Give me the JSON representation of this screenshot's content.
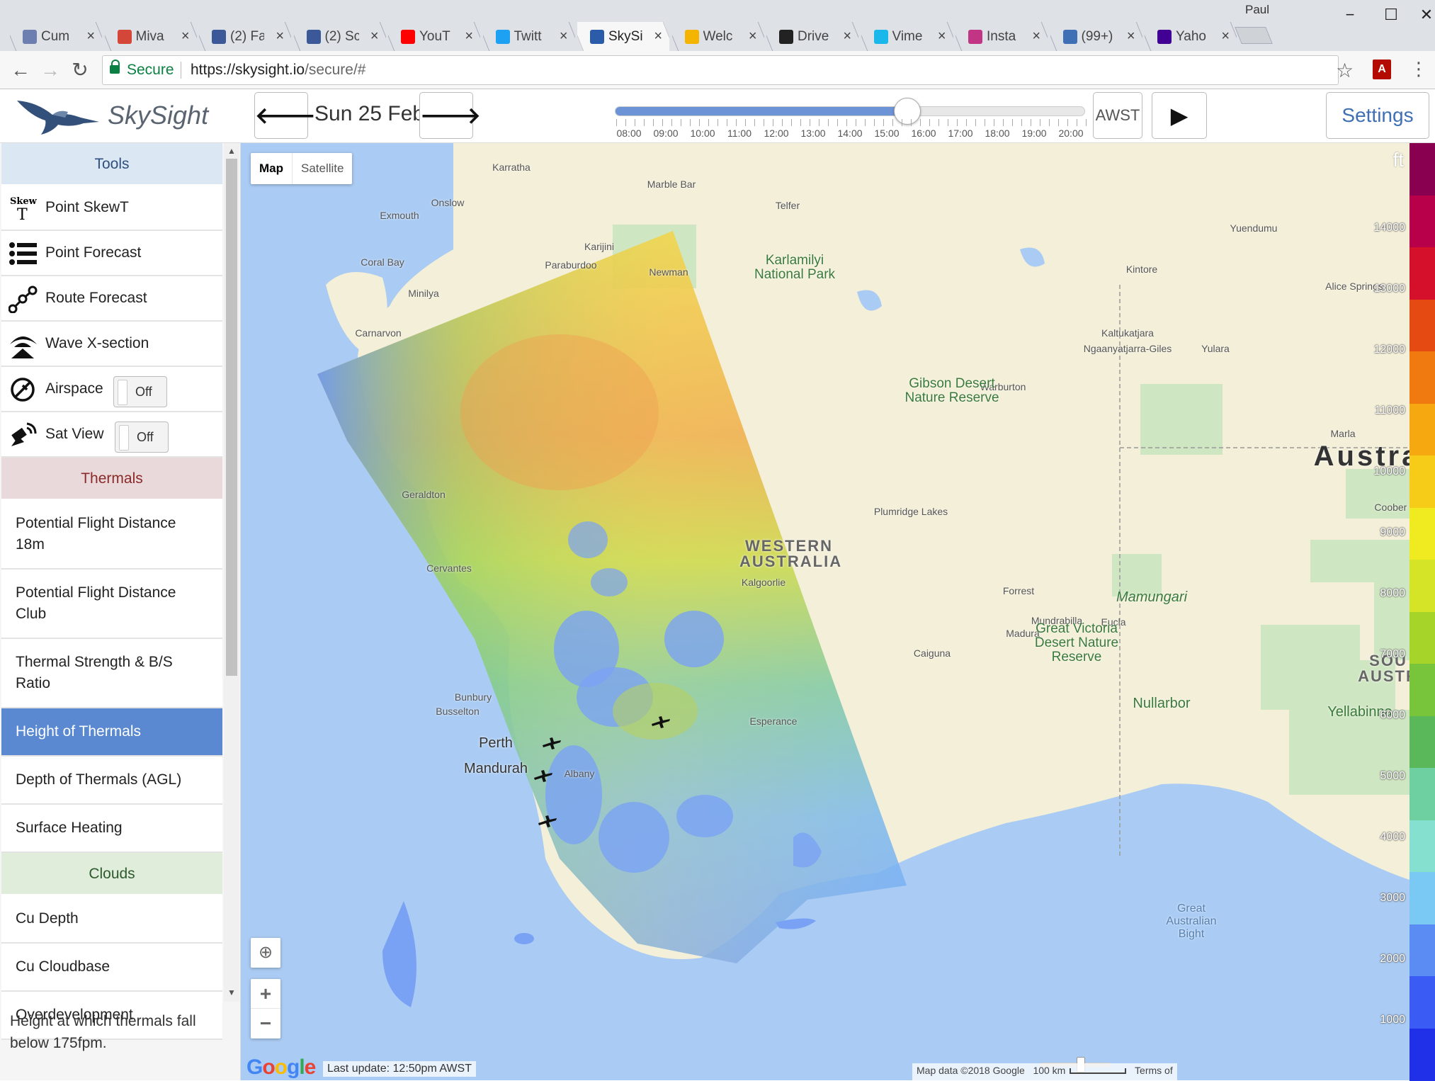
{
  "browser": {
    "profile": "Paul",
    "tabs": [
      {
        "label": "Cum",
        "icon": "feather-icon",
        "color": "#6d7fb0"
      },
      {
        "label": "Miva",
        "icon": "gmail-icon",
        "color": "#d44638"
      },
      {
        "label": "(2) Fa",
        "icon": "facebook-icon",
        "color": "#3b5998"
      },
      {
        "label": "(2) Sc",
        "icon": "facebook-icon",
        "color": "#3b5998"
      },
      {
        "label": "YouT",
        "icon": "youtube-icon",
        "color": "#ff0000"
      },
      {
        "label": "Twitt",
        "icon": "twitter-icon",
        "color": "#1da1f2"
      },
      {
        "label": "SkySi",
        "icon": "plane-icon",
        "color": "#2a5caa",
        "active": true
      },
      {
        "label": "Welc",
        "icon": "pinwheel-icon",
        "color": "#f4b400"
      },
      {
        "label": "Drive",
        "icon": "terminal-icon",
        "color": "#222222"
      },
      {
        "label": "Vime",
        "icon": "vimeo-icon",
        "color": "#1ab7ea"
      },
      {
        "label": "Insta",
        "icon": "instagram-icon",
        "color": "#c13584"
      },
      {
        "label": "(99+)",
        "icon": "mail-icon",
        "color": "#3f6fb5"
      },
      {
        "label": "Yaho",
        "icon": "yahoo-icon",
        "color": "#410093"
      }
    ],
    "secure_label": "Secure",
    "url_host": "https://skysight.io",
    "url_path": "/secure/#"
  },
  "app": {
    "title": "SkySight",
    "date": "Sun 25 Feb",
    "timezone": "AWST",
    "settings": "Settings",
    "time_labels": [
      "08:00",
      "09:00",
      "10:00",
      "11:00",
      "12:00",
      "13:00",
      "14:00",
      "15:00",
      "16:00",
      "17:00",
      "18:00",
      "19:00",
      "20:00"
    ],
    "time_position": 0.62
  },
  "sidebar": {
    "tools_header": "Tools",
    "tools": [
      {
        "label": "Point SkewT",
        "icon": "skewt-icon"
      },
      {
        "label": "Point Forecast",
        "icon": "list-icon"
      },
      {
        "label": "Route Forecast",
        "icon": "route-icon"
      },
      {
        "label": "Wave X-section",
        "icon": "wave-icon"
      },
      {
        "label": "Airspace",
        "icon": "airspace-icon",
        "toggle": "Off"
      },
      {
        "label": "Sat View",
        "icon": "satellite-icon",
        "toggle": "Off"
      }
    ],
    "thermals_header": "Thermals",
    "thermals": [
      "Potential Flight Distance 18m",
      "Potential Flight Distance Club",
      "Thermal Strength & B/S Ratio",
      "Height of Thermals",
      "Depth of Thermals (AGL)",
      "Surface Heating"
    ],
    "clouds_header": "Clouds",
    "clouds": [
      "Cu Depth",
      "Cu Cloudbase",
      "Overdevelopment"
    ],
    "description": "Height at which thermals fall below 175fpm."
  },
  "map": {
    "type_map": "Map",
    "type_satellite": "Satellite",
    "zoom_in": "+",
    "zoom_out": "−",
    "google": "Google",
    "last_update": "Last update: 12:50pm AWST",
    "attribution": "Map data ©2018 Google",
    "scale": "100 km",
    "terms": "Terms of",
    "unit": "ft",
    "labels": {
      "karratha": "Karratha",
      "marble_bar": "Marble Bar",
      "onslow": "Onslow",
      "telfer": "Telfer",
      "exmouth": "Exmouth",
      "karijini": "Karijini",
      "yuendumu": "Yuendumu",
      "coral_bay": "Coral Bay",
      "paraburdoo": "Paraburdoo",
      "newman": "Newman",
      "kintore": "Kintore",
      "alice_springs": "Alice Springs",
      "minilya": "Minilya",
      "carnarvon": "Carnarvon",
      "kaltukatjara": "Kaltukatjara",
      "ngaanyatjarra": "Ngaanyatjarra-Giles",
      "yulara": "Yulara",
      "warburton": "Warburton",
      "marla": "Marla",
      "geraldton": "Geraldton",
      "mamungari": "Mamungari",
      "coober": "Coober P",
      "plumridge": "Plumridge Lakes",
      "cervantes": "Cervantes",
      "kalgoorlie": "Kalgoorlie",
      "forrest": "Forrest",
      "nullarbor": "Nullarbor",
      "yellabinna": "Yellabinna",
      "perth": "Perth",
      "mandurah": "Mandurah",
      "mundrabilla": "Mundrabilla",
      "eucla": "Eucla",
      "madura": "Madura",
      "caiguna": "Caiguna",
      "bunbury": "Bunbury",
      "busselton": "Busselton",
      "esperance": "Esperance",
      "albany": "Albany",
      "karlamilyi": "Karlamilyi National Park",
      "gibson": "Gibson Desert Nature Reserve",
      "great_victoria": "Great Victoria Desert Nature Reserve",
      "western_australia": "WESTERN AUSTRALIA",
      "south_australia": "SOU AUSTR",
      "australia": "Austra",
      "bight": "Great Australian Bight"
    }
  },
  "legend": {
    "labels": [
      "14000",
      "13000",
      "12000",
      "11000",
      "10000",
      "9000",
      "8000",
      "7000",
      "6000",
      "5000",
      "4000",
      "3000",
      "2000",
      "1000"
    ],
    "colors": [
      "#8a0050",
      "#b8004a",
      "#d4102a",
      "#e44a12",
      "#f07a10",
      "#f5a810",
      "#f6cc18",
      "#f0ea20",
      "#d6e428",
      "#a6d428",
      "#78c43a",
      "#5ab85a",
      "#6ed0a0",
      "#86e0d0",
      "#7ac8f4",
      "#5a8cf4",
      "#3a5cf4",
      "#2030e8"
    ]
  }
}
